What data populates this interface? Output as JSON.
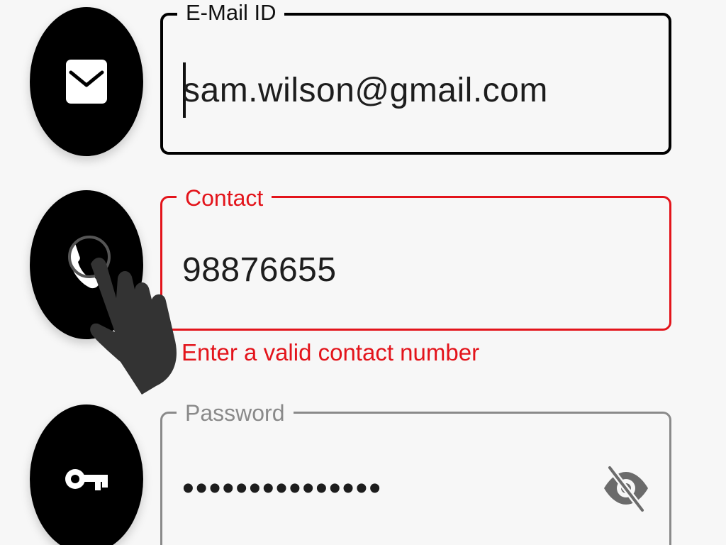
{
  "email_field": {
    "label": "E-Mail ID",
    "value": "sam.wilson@gmail.com",
    "icon": "envelope-icon"
  },
  "contact_field": {
    "label": "Contact",
    "value": "98876655",
    "error": "Enter a valid contact number",
    "icon": "phone-icon"
  },
  "password_field": {
    "label": "Password",
    "value": "•••••••••••••••",
    "icon": "key-icon",
    "toggle_icon": "eye-off-icon"
  },
  "colors": {
    "error": "#e3141b",
    "focused_border": "#000000",
    "inactive_border": "#8a8a8a",
    "icon_circle": "#000000"
  }
}
